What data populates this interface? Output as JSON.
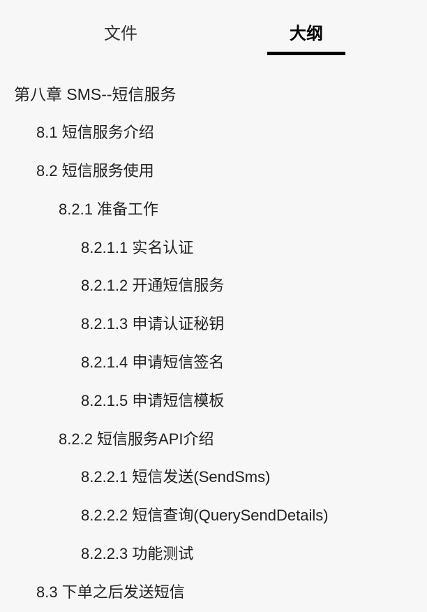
{
  "tabs": {
    "file": "文件",
    "outline": "大纲"
  },
  "outline_items": [
    {
      "level": 0,
      "text": "第八章 SMS--短信服务"
    },
    {
      "level": 1,
      "text": "8.1 短信服务介绍"
    },
    {
      "level": 1,
      "text": "8.2 短信服务使用"
    },
    {
      "level": 2,
      "text": "8.2.1 准备工作"
    },
    {
      "level": 3,
      "text": "8.2.1.1 实名认证"
    },
    {
      "level": 3,
      "text": "8.2.1.2 开通短信服务"
    },
    {
      "level": 3,
      "text": "8.2.1.3 申请认证秘钥"
    },
    {
      "level": 3,
      "text": "8.2.1.4 申请短信签名"
    },
    {
      "level": 3,
      "text": "8.2.1.5 申请短信模板"
    },
    {
      "level": 2,
      "text": "8.2.2 短信服务API介绍"
    },
    {
      "level": 3,
      "text": "8.2.2.1 短信发送(SendSms)"
    },
    {
      "level": 3,
      "text": "8.2.2.2 短信查询(QuerySendDetails)"
    },
    {
      "level": 3,
      "text": "8.2.2.3 功能测试"
    },
    {
      "level": 1,
      "text": "8.3 下单之后发送短信"
    }
  ]
}
